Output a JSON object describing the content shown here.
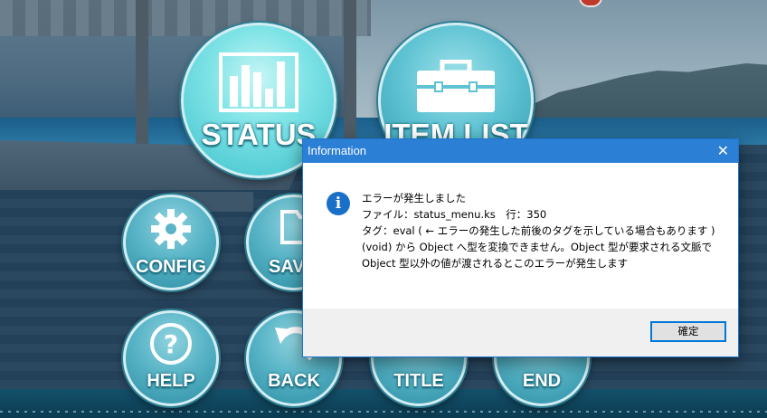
{
  "menu": {
    "status_label": "STATUS",
    "itemlist_label": "ITEM LIST",
    "config_label": "CONFIG",
    "save_label": "SAV",
    "help_label": "HELP",
    "back_label": "BACK",
    "title_label": "TITLE",
    "end_label": "END"
  },
  "dialog": {
    "title": "Information",
    "close_glyph": "✕",
    "icon_glyph": "i",
    "lines": [
      "エラーが発生しました",
      "ファイル：status_menu.ks　行：350",
      "タグ：eval ( ← エラーの発生した前後のタグを示している場合もあります )",
      "(void) から Object へ型を変換できません。Object 型が要求される文脈で Object 型以外の値が渡されるとこのエラーが発生します"
    ],
    "ok_label": "確定"
  },
  "colors": {
    "titlebar": "#2b7fd4",
    "info_icon": "#1a6fc9",
    "button_focus_border": "#0078d7",
    "menu_button": "#58b4c6"
  },
  "icons": [
    "bar-chart-icon",
    "briefcase-icon",
    "gear-icon",
    "folder-icon",
    "question-icon",
    "back-arrow-icon",
    "info-icon",
    "close-icon"
  ]
}
